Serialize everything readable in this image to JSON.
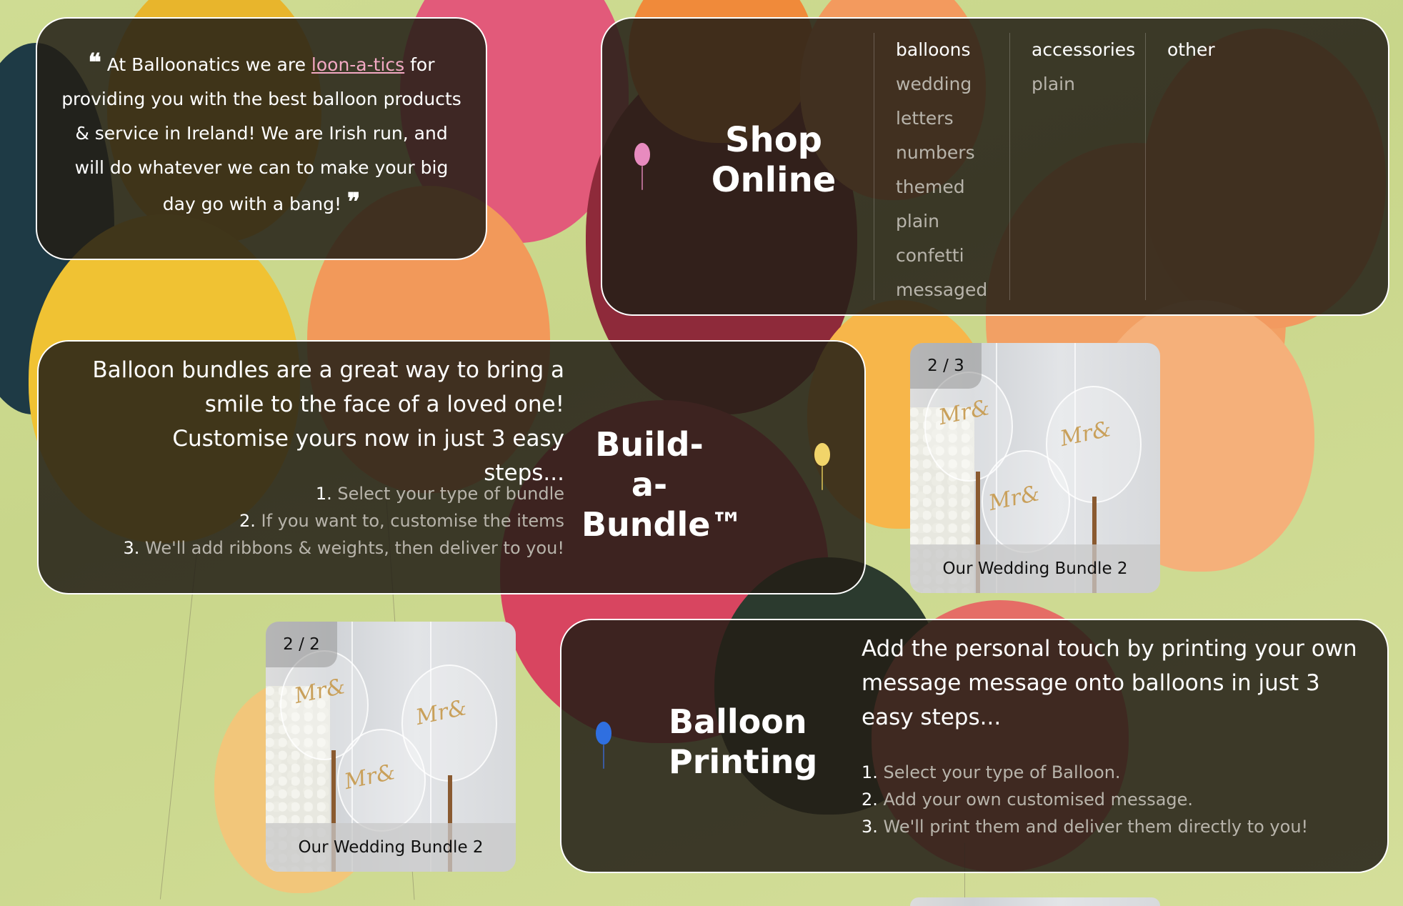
{
  "colors": {
    "card_bg": "#231e16",
    "link": "#f2a8c3",
    "muted_text": "#b8b4ab"
  },
  "quote": {
    "open_mark": "❝",
    "text_before": "At Balloonatics we are",
    "link": "loon-a-tics",
    "text_after": "for providing you with the best balloon products & service in Ireland! We are Irish run, and will do whatever we can to make your big day go with a bang!",
    "close_mark": "❞"
  },
  "shop": {
    "title_line1": "Shop",
    "title_line2": "Online",
    "icon": "pink-balloon-icon",
    "columns": [
      {
        "heading": "balloons",
        "items": [
          "wedding",
          "letters",
          "numbers",
          "themed",
          "plain",
          "confetti",
          "messaged"
        ]
      },
      {
        "heading": "accessories",
        "items": [
          "plain"
        ]
      },
      {
        "heading": "other",
        "items": []
      }
    ]
  },
  "bundle": {
    "intro": "Balloon bundles are a great way to bring a smile to the face of a loved one! Customise yours now in just 3 easy steps...",
    "steps": [
      {
        "n": "1.",
        "text": "Select your type of bundle"
      },
      {
        "n": "2.",
        "text": "If you want to, customise the items"
      },
      {
        "n": "3.",
        "text": "We'll add ribbons & weights, then deliver to you!"
      }
    ],
    "title_line1": "Build-a-",
    "title_line2": "Bundle™",
    "icon": "yellow-balloon-icon"
  },
  "printing": {
    "title_line1": "Balloon",
    "title_line2": "Printing",
    "icon": "blue-balloon-icon",
    "intro": "Add the personal touch by printing your own message message onto balloons in just 3 easy steps...",
    "steps": [
      {
        "n": "1.",
        "text": "Select your type of Balloon."
      },
      {
        "n": "2.",
        "text": "Add your own customised message."
      },
      {
        "n": "3.",
        "text": "We'll print them and deliver them directly to you!"
      }
    ]
  },
  "slides": [
    {
      "counter": "2 / 3",
      "caption": "Our Wedding Bundle 2"
    },
    {
      "counter": "2 / 2",
      "caption": "Our Wedding Bundle 2"
    }
  ]
}
